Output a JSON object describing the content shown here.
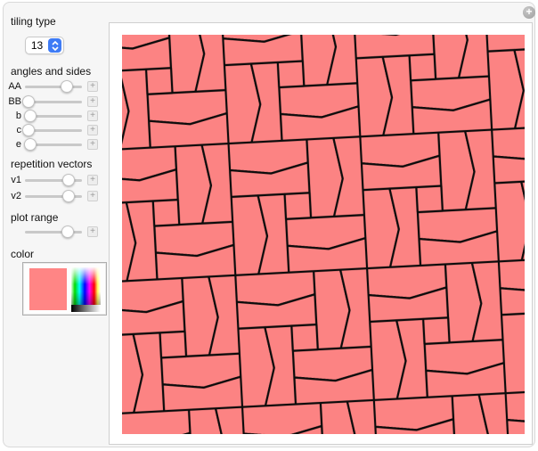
{
  "window": {
    "expand_button": "+"
  },
  "controls": {
    "tiling_type": {
      "label": "tiling type",
      "value": "13"
    },
    "angles_section": "angles and sides",
    "angle_sliders": [
      {
        "label": "AA",
        "pct": 73
      },
      {
        "label": "BB",
        "pct": 6
      },
      {
        "label": "b",
        "pct": 9
      },
      {
        "label": "c",
        "pct": 7
      },
      {
        "label": "e",
        "pct": 9
      }
    ],
    "vectors_section": "repetition vectors",
    "vector_sliders": [
      {
        "label": "v1",
        "pct": 77
      },
      {
        "label": "v2",
        "pct": 77
      }
    ],
    "plot_range_section": "plot range",
    "plot_range_slider": {
      "pct": 75
    },
    "color_section": "color",
    "plus_label": "+"
  },
  "plot": {
    "tile_fill": "#FC8383",
    "edge_color": "#0b0b0b",
    "swatch_fill": "#FF8585"
  }
}
